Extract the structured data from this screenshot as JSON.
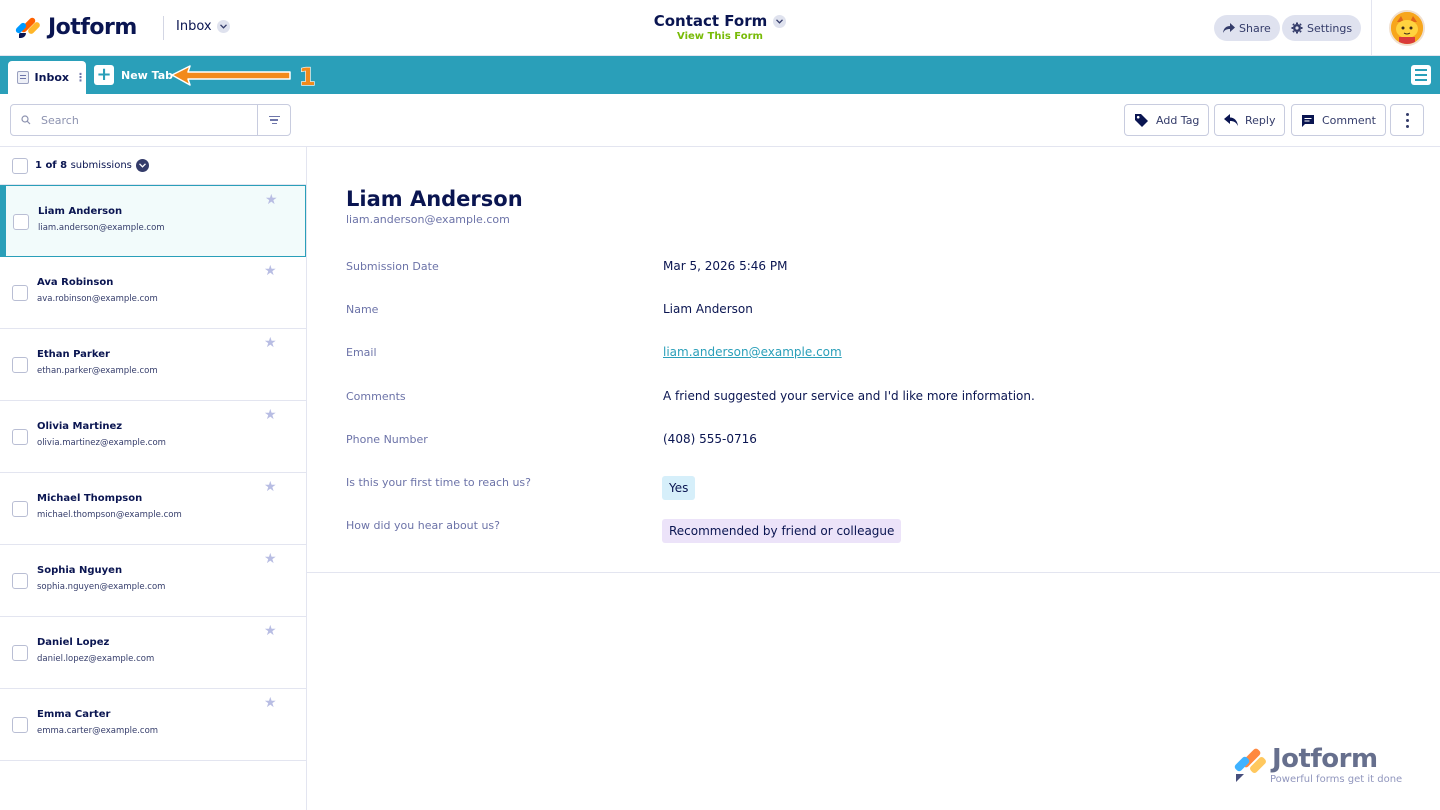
{
  "header": {
    "logo_text": "Jotform",
    "inbox_label": "Inbox",
    "form_title": "Contact Form",
    "view_form_label": "View This Form",
    "share_label": "Share",
    "settings_label": "Settings"
  },
  "tabs": {
    "inbox_tab_label": "Inbox",
    "new_tab_label": "New Tab",
    "annotation_number": "1"
  },
  "toolbar": {
    "search_placeholder": "Search",
    "add_tag_label": "Add Tag",
    "reply_label": "Reply",
    "comment_label": "Comment"
  },
  "list": {
    "count_current": "1 of 8",
    "count_suffix": "submissions",
    "items": [
      {
        "name": "Liam Anderson",
        "email": "liam.anderson@example.com"
      },
      {
        "name": "Ava Robinson",
        "email": "ava.robinson@example.com"
      },
      {
        "name": "Ethan Parker",
        "email": "ethan.parker@example.com"
      },
      {
        "name": "Olivia Martinez",
        "email": "olivia.martinez@example.com"
      },
      {
        "name": "Michael Thompson",
        "email": "michael.thompson@example.com"
      },
      {
        "name": "Sophia Nguyen",
        "email": "sophia.nguyen@example.com"
      },
      {
        "name": "Daniel Lopez",
        "email": "daniel.lopez@example.com"
      },
      {
        "name": "Emma Carter",
        "email": "emma.carter@example.com"
      }
    ]
  },
  "submission": {
    "name": "Liam Anderson",
    "email": "liam.anderson@example.com",
    "fields": [
      {
        "label": "Submission Date",
        "value": "Mar 5, 2026 5:46 PM"
      },
      {
        "label": "Name",
        "value": "Liam Anderson"
      },
      {
        "label": "Email",
        "value": "liam.anderson@example.com"
      },
      {
        "label": "Comments",
        "value": "A friend suggested your service and I'd like more information."
      },
      {
        "label": "Phone Number",
        "value": "(408) 555-0716"
      },
      {
        "label": "Is this your first time to reach us?",
        "value": "Yes"
      },
      {
        "label": "How did you hear about us?",
        "value": "Recommended by friend or colleague"
      }
    ]
  },
  "watermark": {
    "brand": "Jotform",
    "tagline": "Powerful forms get it done"
  },
  "colors": {
    "accent": "#2a9fb9",
    "navy": "#0a1551",
    "view_form_green": "#78bb07",
    "annotation_orange": "#f28a1c",
    "pill_yes_bg": "#d6effa",
    "pill_source_bg": "#ece3f9"
  }
}
